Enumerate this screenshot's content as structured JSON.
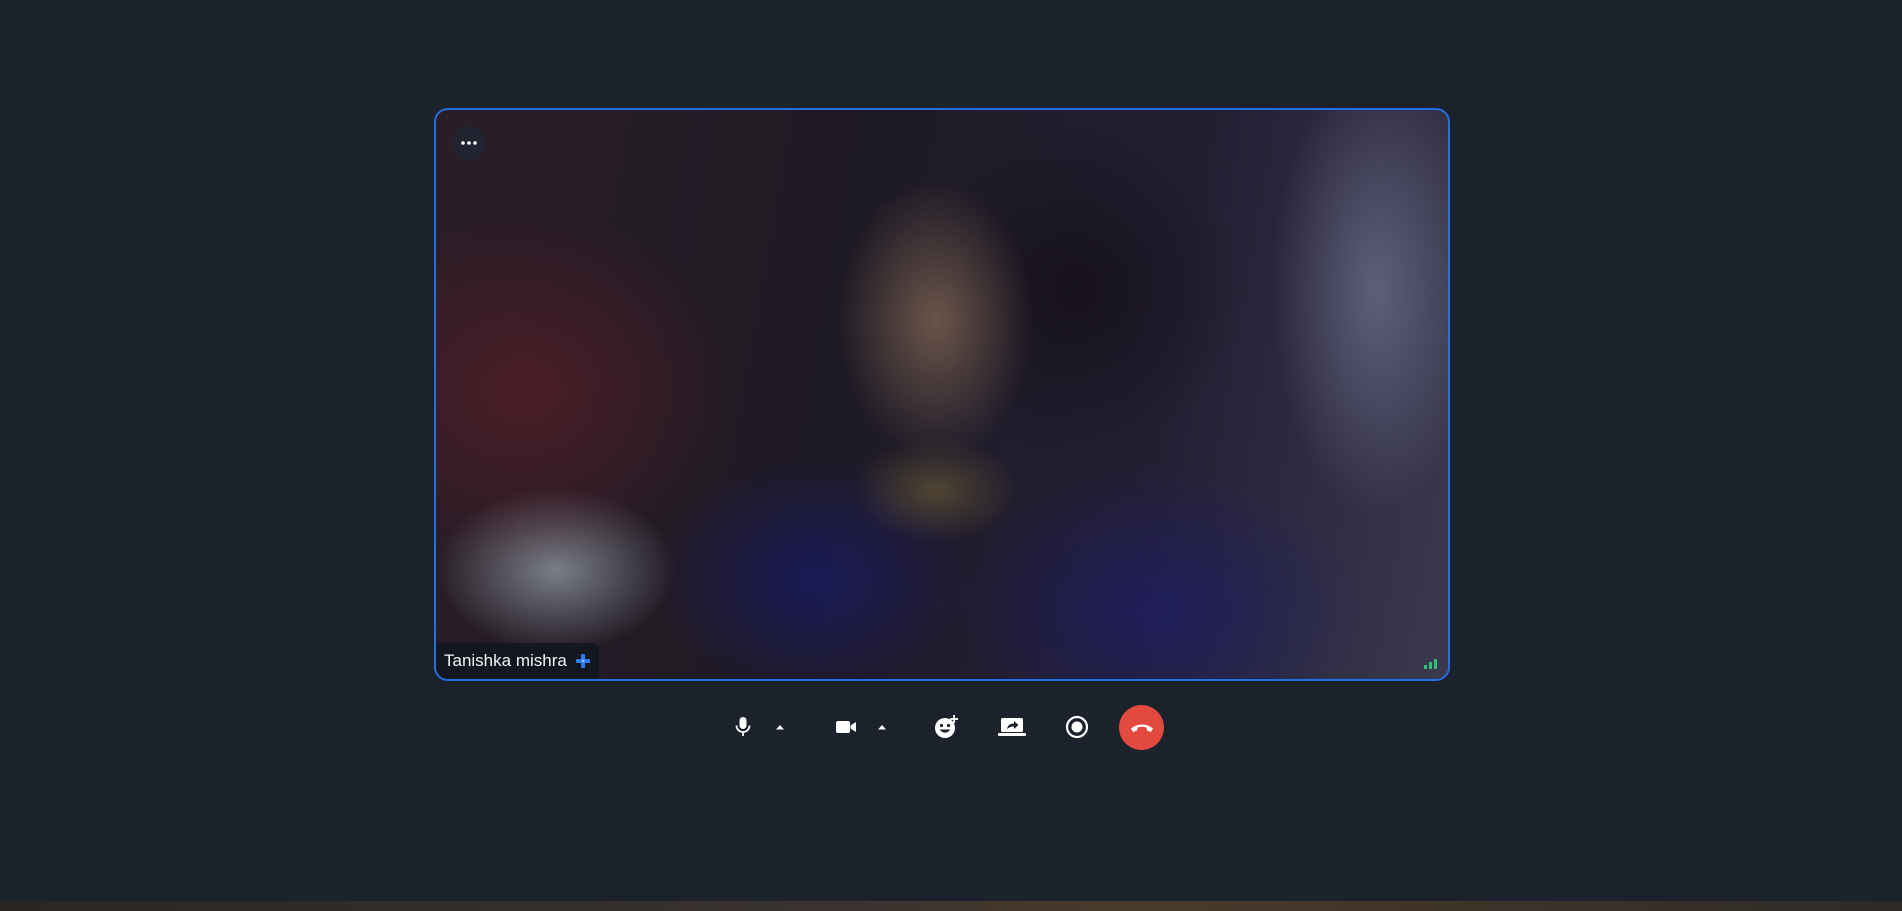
{
  "participant": {
    "name": "Tanishka mishra",
    "badge_icon": "pro-plus-icon"
  },
  "tile": {
    "more_icon": "more-horizontal-icon",
    "signal_icon": "signal-strength-icon",
    "border_color": "#246fe5",
    "signal_color": "#2fbf71"
  },
  "controls": {
    "items": [
      {
        "name": "microphone",
        "icon": "microphone-icon"
      },
      {
        "name": "audio-options",
        "icon": "caret-up-icon"
      },
      {
        "name": "camera",
        "icon": "video-camera-icon"
      },
      {
        "name": "video-options",
        "icon": "caret-up-icon"
      },
      {
        "name": "reactions",
        "icon": "emoji-add-icon"
      },
      {
        "name": "share-screen",
        "icon": "screen-share-icon"
      },
      {
        "name": "record",
        "icon": "record-icon"
      },
      {
        "name": "leave-call",
        "icon": "phone-hangup-icon"
      }
    ],
    "hangup_color": "#e24a3f"
  },
  "colors": {
    "background": "#1b222b",
    "icon": "#ffffff"
  }
}
